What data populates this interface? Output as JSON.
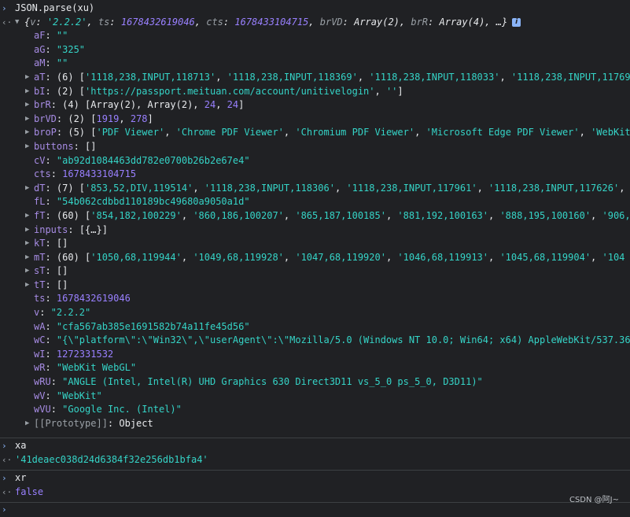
{
  "input1": "JSON.parse(xu)",
  "summary": {
    "open": "{",
    "parts": [
      {
        "k": "v",
        "val": "'2.2.2'",
        "t": "str"
      },
      {
        "k": "ts",
        "val": "1678432619046",
        "t": "num"
      },
      {
        "k": "cts",
        "val": "1678433104715",
        "t": "num"
      },
      {
        "k": "brVD",
        "val": "Array(2)",
        "t": "plain"
      },
      {
        "k": "brR",
        "val": "Array(4)",
        "t": "plain"
      }
    ],
    "tail": "…}",
    "info": "i"
  },
  "props": [
    {
      "key": "aF",
      "expand": false,
      "seg": [
        {
          "t": "str",
          "v": "\"\""
        }
      ]
    },
    {
      "key": "aG",
      "expand": false,
      "seg": [
        {
          "t": "str",
          "v": "\"325\""
        }
      ]
    },
    {
      "key": "aM",
      "expand": false,
      "seg": [
        {
          "t": "str",
          "v": "\"\""
        }
      ]
    },
    {
      "key": "aT",
      "expand": true,
      "seg": [
        {
          "t": "plain",
          "v": "(6) ["
        },
        {
          "t": "str",
          "v": "'1118,238,INPUT,118713'"
        },
        {
          "t": "plain",
          "v": ", "
        },
        {
          "t": "str",
          "v": "'1118,238,INPUT,118369'"
        },
        {
          "t": "plain",
          "v": ", "
        },
        {
          "t": "str",
          "v": "'1118,238,INPUT,118033'"
        },
        {
          "t": "plain",
          "v": ", "
        },
        {
          "t": "str",
          "v": "'1118,238,INPUT,11769"
        }
      ]
    },
    {
      "key": "bI",
      "expand": true,
      "seg": [
        {
          "t": "plain",
          "v": "(2) ["
        },
        {
          "t": "str",
          "v": "'https://passport.meituan.com/account/unitivelogin'"
        },
        {
          "t": "plain",
          "v": ", "
        },
        {
          "t": "str",
          "v": "''"
        },
        {
          "t": "plain",
          "v": "]"
        }
      ]
    },
    {
      "key": "brR",
      "expand": true,
      "seg": [
        {
          "t": "plain",
          "v": "(4) [Array(2), Array(2), "
        },
        {
          "t": "num",
          "v": "24"
        },
        {
          "t": "plain",
          "v": ", "
        },
        {
          "t": "num",
          "v": "24"
        },
        {
          "t": "plain",
          "v": "]"
        }
      ]
    },
    {
      "key": "brVD",
      "expand": true,
      "seg": [
        {
          "t": "plain",
          "v": "(2) ["
        },
        {
          "t": "num",
          "v": "1919"
        },
        {
          "t": "plain",
          "v": ", "
        },
        {
          "t": "num",
          "v": "278"
        },
        {
          "t": "plain",
          "v": "]"
        }
      ]
    },
    {
      "key": "broP",
      "expand": true,
      "seg": [
        {
          "t": "plain",
          "v": "(5) ["
        },
        {
          "t": "str",
          "v": "'PDF Viewer'"
        },
        {
          "t": "plain",
          "v": ", "
        },
        {
          "t": "str",
          "v": "'Chrome PDF Viewer'"
        },
        {
          "t": "plain",
          "v": ", "
        },
        {
          "t": "str",
          "v": "'Chromium PDF Viewer'"
        },
        {
          "t": "plain",
          "v": ", "
        },
        {
          "t": "str",
          "v": "'Microsoft Edge PDF Viewer'"
        },
        {
          "t": "plain",
          "v": ", "
        },
        {
          "t": "str",
          "v": "'WebKit"
        }
      ]
    },
    {
      "key": "buttons",
      "expand": true,
      "seg": [
        {
          "t": "plain",
          "v": "[]"
        }
      ]
    },
    {
      "key": "cV",
      "expand": false,
      "seg": [
        {
          "t": "str",
          "v": "\"ab92d1084463dd782e0700b26b2e67e4\""
        }
      ]
    },
    {
      "key": "cts",
      "expand": false,
      "seg": [
        {
          "t": "num",
          "v": "1678433104715"
        }
      ]
    },
    {
      "key": "dT",
      "expand": true,
      "seg": [
        {
          "t": "plain",
          "v": "(7) ["
        },
        {
          "t": "str",
          "v": "'853,52,DIV,119514'"
        },
        {
          "t": "plain",
          "v": ", "
        },
        {
          "t": "str",
          "v": "'1118,238,INPUT,118306'"
        },
        {
          "t": "plain",
          "v": ", "
        },
        {
          "t": "str",
          "v": "'1118,238,INPUT,117961'"
        },
        {
          "t": "plain",
          "v": ", "
        },
        {
          "t": "str",
          "v": "'1118,238,INPUT,117626'"
        },
        {
          "t": "plain",
          "v": ", "
        }
      ]
    },
    {
      "key": "fL",
      "expand": false,
      "seg": [
        {
          "t": "str",
          "v": "\"54b062cdbbd110189bc49680a9050a1d\""
        }
      ]
    },
    {
      "key": "fT",
      "expand": true,
      "seg": [
        {
          "t": "plain",
          "v": "(60) ["
        },
        {
          "t": "str",
          "v": "'854,182,100229'"
        },
        {
          "t": "plain",
          "v": ", "
        },
        {
          "t": "str",
          "v": "'860,186,100207'"
        },
        {
          "t": "plain",
          "v": ", "
        },
        {
          "t": "str",
          "v": "'865,187,100185'"
        },
        {
          "t": "plain",
          "v": ", "
        },
        {
          "t": "str",
          "v": "'881,192,100163'"
        },
        {
          "t": "plain",
          "v": ", "
        },
        {
          "t": "str",
          "v": "'888,195,100160'"
        },
        {
          "t": "plain",
          "v": ", "
        },
        {
          "t": "str",
          "v": "'906,"
        }
      ]
    },
    {
      "key": "inputs",
      "expand": true,
      "seg": [
        {
          "t": "plain",
          "v": "[{…}]"
        }
      ]
    },
    {
      "key": "kT",
      "expand": true,
      "seg": [
        {
          "t": "plain",
          "v": "[]"
        }
      ]
    },
    {
      "key": "mT",
      "expand": true,
      "seg": [
        {
          "t": "plain",
          "v": "(60) ["
        },
        {
          "t": "str",
          "v": "'1050,68,119944'"
        },
        {
          "t": "plain",
          "v": ", "
        },
        {
          "t": "str",
          "v": "'1049,68,119928'"
        },
        {
          "t": "plain",
          "v": ", "
        },
        {
          "t": "str",
          "v": "'1047,68,119920'"
        },
        {
          "t": "plain",
          "v": ", "
        },
        {
          "t": "str",
          "v": "'1046,68,119913'"
        },
        {
          "t": "plain",
          "v": ", "
        },
        {
          "t": "str",
          "v": "'1045,68,119904'"
        },
        {
          "t": "plain",
          "v": ", "
        },
        {
          "t": "str",
          "v": "'104"
        }
      ]
    },
    {
      "key": "sT",
      "expand": true,
      "seg": [
        {
          "t": "plain",
          "v": "[]"
        }
      ]
    },
    {
      "key": "tT",
      "expand": true,
      "seg": [
        {
          "t": "plain",
          "v": "[]"
        }
      ]
    },
    {
      "key": "ts",
      "expand": false,
      "seg": [
        {
          "t": "num",
          "v": "1678432619046"
        }
      ]
    },
    {
      "key": "v",
      "expand": false,
      "seg": [
        {
          "t": "str",
          "v": "\"2.2.2\""
        }
      ]
    },
    {
      "key": "wA",
      "expand": false,
      "seg": [
        {
          "t": "str",
          "v": "\"cfa567ab385e1691582b74a11fe45d56\""
        }
      ]
    },
    {
      "key": "wC",
      "expand": false,
      "seg": [
        {
          "t": "str",
          "v": "\"{\\\"platform\\\":\\\"Win32\\\",\\\"userAgent\\\":\\\"Mozilla/5.0 (Windows NT 10.0; Win64; x64) AppleWebKit/537.36"
        }
      ]
    },
    {
      "key": "wI",
      "expand": false,
      "seg": [
        {
          "t": "num",
          "v": "1272331532"
        }
      ]
    },
    {
      "key": "wR",
      "expand": false,
      "seg": [
        {
          "t": "str",
          "v": "\"WebKit WebGL\""
        }
      ]
    },
    {
      "key": "wRU",
      "expand": false,
      "seg": [
        {
          "t": "str",
          "v": "\"ANGLE (Intel, Intel(R) UHD Graphics 630 Direct3D11 vs_5_0 ps_5_0, D3D11)\""
        }
      ]
    },
    {
      "key": "wV",
      "expand": false,
      "seg": [
        {
          "t": "str",
          "v": "\"WebKit\""
        }
      ]
    },
    {
      "key": "wVU",
      "expand": false,
      "seg": [
        {
          "t": "str",
          "v": "\"Google Inc. (Intel)\""
        }
      ]
    },
    {
      "key": "[[Prototype]]",
      "expand": true,
      "proto": true,
      "seg": [
        {
          "t": "plain",
          "v": "Object"
        }
      ]
    }
  ],
  "input2": "xa",
  "result2": "'41deaec038d24d6384f32e256db1bfa4'",
  "input3": "xr",
  "result3": "false",
  "watermark": "CSDN @阿J~"
}
